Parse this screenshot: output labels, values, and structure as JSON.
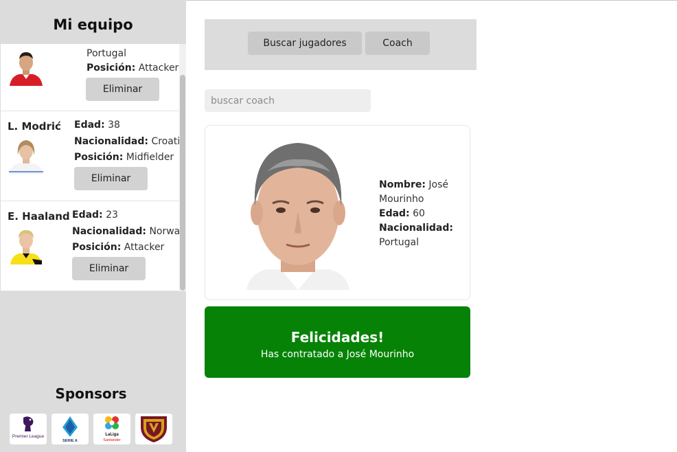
{
  "sidebar": {
    "title": "Mi equipo",
    "labels": {
      "age": "Edad:",
      "nationality": "Nacionalidad:",
      "position": "Posición:"
    },
    "remove_label": "Eliminar",
    "players": [
      {
        "name": "",
        "age": "",
        "nationality": "Portugal",
        "position": "Attacker"
      },
      {
        "name": "L. Modrić",
        "age": "38",
        "nationality": "Croatia",
        "position": "Midfielder"
      },
      {
        "name": "E. Haaland",
        "age": "23",
        "nationality": "Norway",
        "position": "Attacker"
      }
    ],
    "sponsors_title": "Sponsors",
    "sponsors": [
      {
        "icon": "premier-league-logo",
        "text": "Premier League"
      },
      {
        "icon": "serie-a-logo",
        "text": "SERIE A"
      },
      {
        "icon": "laliga-logo",
        "text": "LaLiga Santander"
      },
      {
        "icon": "venezuela-federation-logo",
        "text": ""
      }
    ]
  },
  "tabs": {
    "search_players": "Buscar jugadores",
    "coach": "Coach"
  },
  "search": {
    "placeholder": "buscar coach",
    "value": ""
  },
  "coach": {
    "name_label": "Nombre:",
    "name": "José Mourinho",
    "age_label": "Edad:",
    "age": "60",
    "nationality_label": "Nacionalidad:",
    "nationality": "Portugal"
  },
  "success": {
    "title": "Felicidades!",
    "message": "Has contratado a José Mourinho"
  },
  "colors": {
    "sidebar_bg": "#dcdcdc",
    "button_bg": "#d2d2d2",
    "success_green": "#068306"
  }
}
